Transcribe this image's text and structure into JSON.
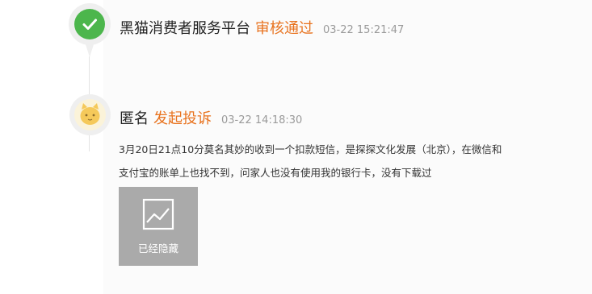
{
  "events": [
    {
      "actor": "黑猫消费者服务平台",
      "action": "审核通过",
      "time": "03-22 15:21:47",
      "icon": "check-icon"
    },
    {
      "actor": "匿名",
      "action": "发起投诉",
      "time": "03-22 14:18:30",
      "icon": "cat-avatar-icon",
      "content_line1": "3月20日21点10分莫名其妙的收到一个扣款短信，是探探文化发展（北京），在微信和",
      "content_line2": "支付宝的账单上也找不到，问家人也没有使用我的银行卡，没有下载过",
      "attachment": {
        "label": "已经隐藏",
        "icon": "image-placeholder-icon"
      }
    }
  ],
  "colors": {
    "accent": "#e8731f",
    "success": "#4cb64c",
    "placeholder_bg": "#aaaaaa"
  }
}
